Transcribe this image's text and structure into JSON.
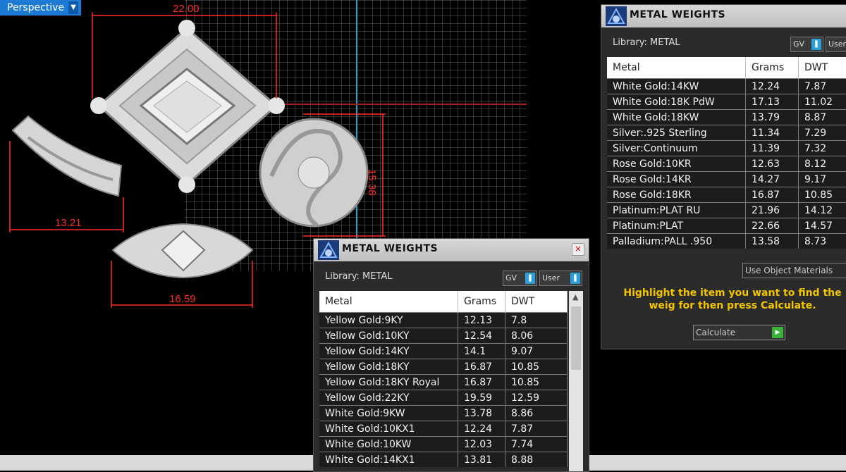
{
  "viewport": {
    "mode_label": "Perspective",
    "dimensions": [
      "22.00",
      "13.21",
      "15.38",
      "16.59"
    ]
  },
  "panel_main": {
    "title": "METAL WEIGHTS",
    "library_label": "Library: METAL",
    "gv_label": "GV",
    "user_label": "User",
    "columns": [
      "Metal",
      "Grams",
      "DWT"
    ],
    "rows": [
      [
        "White Gold:14KW",
        "12.24",
        "7.87"
      ],
      [
        "White Gold:18K PdW",
        "17.13",
        "11.02"
      ],
      [
        "White Gold:18KW",
        "13.79",
        "8.87"
      ],
      [
        "Silver:.925 Sterling",
        "11.34",
        "7.29"
      ],
      [
        "Silver:Continuum",
        "11.39",
        "7.32"
      ],
      [
        "Rose Gold:10KR",
        "12.63",
        "8.12"
      ],
      [
        "Rose Gold:14KR",
        "14.27",
        "9.17"
      ],
      [
        "Rose Gold:18KR",
        "16.87",
        "10.85"
      ],
      [
        "Platinum:PLAT RU",
        "21.96",
        "14.12"
      ],
      [
        "Platinum:PLAT",
        "22.66",
        "14.57"
      ],
      [
        "Palladium:PALL .950",
        "13.58",
        "8.73"
      ]
    ],
    "materials_option": "Use Object Materials",
    "hint": "Highlight the item you want to find the weig for then press Calculate.",
    "calculate_label": "Calculate"
  },
  "panel_float": {
    "title": "METAL WEIGHTS",
    "close_glyph": "×",
    "library_label": "Library: METAL",
    "gv_label": "GV",
    "user_label": "User",
    "columns": [
      "Metal",
      "Grams",
      "DWT"
    ],
    "rows": [
      [
        "Yellow Gold:9KY",
        "12.13",
        "7.8"
      ],
      [
        "Yellow Gold:10KY",
        "12.54",
        "8.06"
      ],
      [
        "Yellow Gold:14KY",
        "14.1",
        "9.07"
      ],
      [
        "Yellow Gold:18KY",
        "16.87",
        "10.85"
      ],
      [
        "Yellow Gold:18KY Royal",
        "16.87",
        "10.85"
      ],
      [
        "Yellow Gold:22KY",
        "19.59",
        "12.59"
      ],
      [
        "White Gold:9KW",
        "13.78",
        "8.86"
      ],
      [
        "White Gold:10KX1",
        "12.24",
        "7.87"
      ],
      [
        "White Gold:10KW",
        "12.03",
        "7.74"
      ],
      [
        "White Gold:14KX1",
        "13.81",
        "8.88"
      ]
    ]
  }
}
